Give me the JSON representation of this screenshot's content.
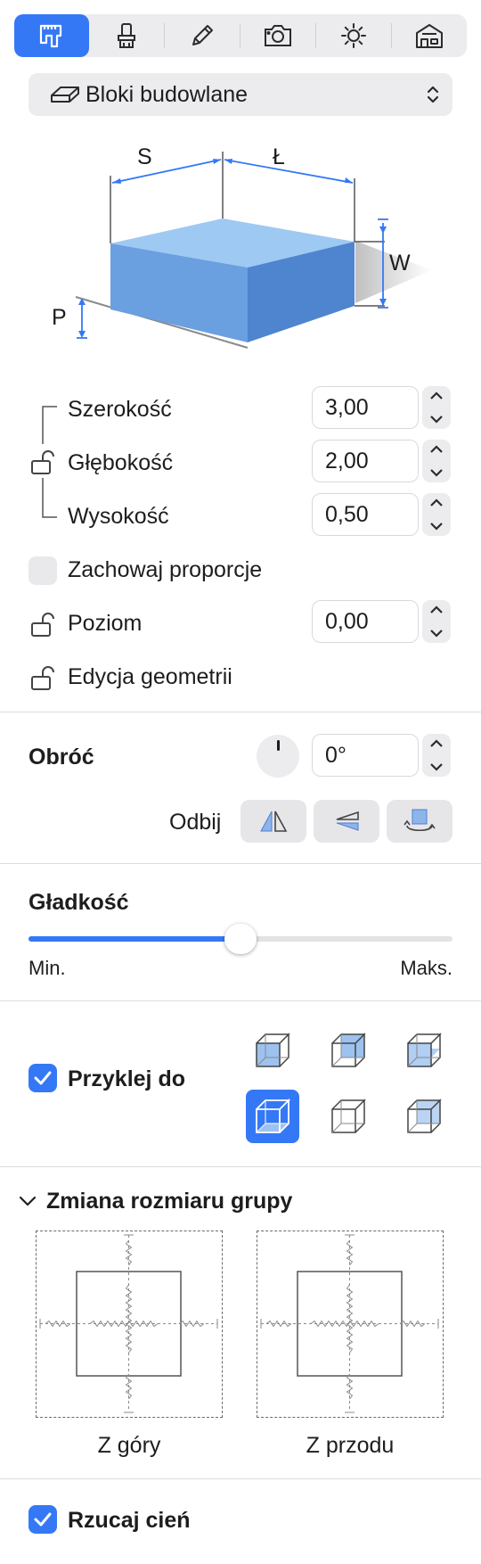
{
  "toolbar": {
    "tabs": [
      {
        "icon": "ruler-tool-icon",
        "active": true
      },
      {
        "icon": "brush-icon",
        "active": false
      },
      {
        "icon": "pencil-icon",
        "active": false
      },
      {
        "icon": "camera-icon",
        "active": false
      },
      {
        "icon": "sun-icon",
        "active": false
      },
      {
        "icon": "building-icon",
        "active": false
      }
    ]
  },
  "object_type": {
    "icon": "eraser-block-icon",
    "label": "Bloki budowlane"
  },
  "diagram": {
    "labels": {
      "s": "S",
      "l": "Ł",
      "w": "W",
      "p": "P"
    },
    "colors": {
      "top": "#9ec9f2",
      "front": "#6a9fe0",
      "side": "#4f84cf"
    }
  },
  "dimensions": {
    "width": {
      "label": "Szerokość",
      "value": "3,00"
    },
    "depth": {
      "label": "Głębokość",
      "value": "2,00"
    },
    "height": {
      "label": "Wysokość",
      "value": "0,50"
    },
    "keep_proportions": {
      "label": "Zachowaj proporcje",
      "checked": false
    },
    "level": {
      "label": "Poziom",
      "value": "0,00"
    },
    "edit_geometry": {
      "label": "Edycja geometrii"
    }
  },
  "rotate": {
    "label": "Obróć",
    "value": "0°",
    "mirror_label": "Odbij"
  },
  "smoothness": {
    "label": "Gładkość",
    "min_label": "Min.",
    "max_label": "Maks.",
    "value": 0.5
  },
  "stick": {
    "label": "Przyklej do",
    "checked": true,
    "active_index": 3
  },
  "group_resize": {
    "title": "Zmiana rozmiaru grupy",
    "top_label": "Z góry",
    "front_label": "Z przodu"
  },
  "shadow": {
    "label": "Rzucaj cień",
    "checked": true
  },
  "accent": "#3478f6"
}
